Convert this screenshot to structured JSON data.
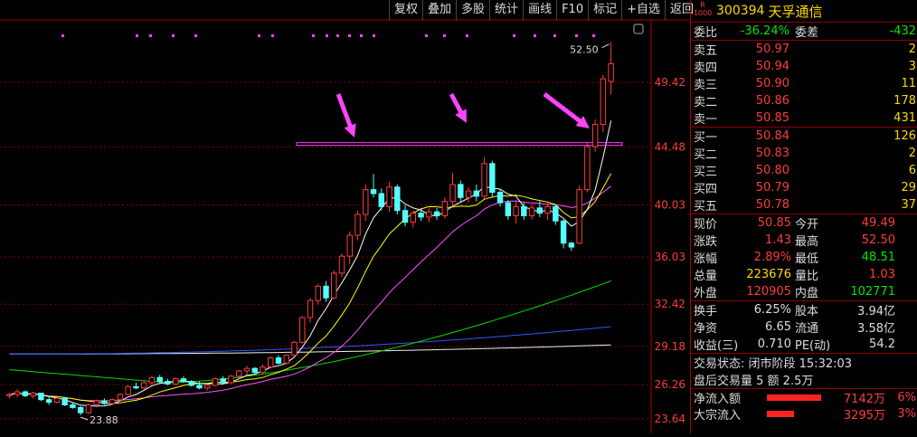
{
  "toolbar": [
    "复权",
    "叠加",
    "多股",
    "统计",
    "画线",
    "F10",
    "标记",
    "+自选",
    "返回"
  ],
  "stock": {
    "badge_top": "R",
    "badge_bottom": "1000",
    "code": "300394",
    "name": "天孚通信"
  },
  "weibi": {
    "label": "委比",
    "value": "-36.24%",
    "label2": "委差",
    "value2": "-432"
  },
  "asks": [
    {
      "label": "卖五",
      "price": "50.97",
      "vol": "2"
    },
    {
      "label": "卖四",
      "price": "50.94",
      "vol": "3"
    },
    {
      "label": "卖三",
      "price": "50.90",
      "vol": "11"
    },
    {
      "label": "卖二",
      "price": "50.86",
      "vol": "178"
    },
    {
      "label": "卖一",
      "price": "50.85",
      "vol": "431"
    }
  ],
  "bids": [
    {
      "label": "买一",
      "price": "50.84",
      "vol": "126"
    },
    {
      "label": "买二",
      "price": "50.83",
      "vol": "2"
    },
    {
      "label": "买三",
      "price": "50.80",
      "vol": "6"
    },
    {
      "label": "买四",
      "price": "50.79",
      "vol": "29"
    },
    {
      "label": "买五",
      "price": "50.78",
      "vol": "37"
    }
  ],
  "quote": [
    {
      "l1": "现价",
      "v1": "50.85",
      "c1": "red",
      "l2": "今开",
      "v2": "49.49",
      "c2": "red"
    },
    {
      "l1": "涨跌",
      "v1": "1.43",
      "c1": "red",
      "l2": "最高",
      "v2": "52.50",
      "c2": "red"
    },
    {
      "l1": "涨幅",
      "v1": "2.89%",
      "c1": "red",
      "l2": "最低",
      "v2": "48.51",
      "c2": "green"
    },
    {
      "l1": "总量",
      "v1": "223676",
      "c1": "yellow",
      "l2": "量比",
      "v2": "1.03",
      "c2": "red"
    },
    {
      "l1": "外盘",
      "v1": "120905",
      "c1": "red",
      "l2": "内盘",
      "v2": "102771",
      "c2": "green"
    }
  ],
  "stats": [
    {
      "l1": "换手",
      "v1": "6.25%",
      "l2": "股本",
      "v2": "3.94亿"
    },
    {
      "l1": "净资",
      "v1": "6.65",
      "l2": "流通",
      "v2": "3.58亿"
    },
    {
      "l1": "收益(三)",
      "v1": "0.710",
      "l2": "PE(动)",
      "v2": "54.2"
    }
  ],
  "status": {
    "line1": "交易状态: 闭市阶段 15:32:03",
    "line2": "盘后交易量 5 额 2.5万"
  },
  "flows": [
    {
      "label": "净流入额",
      "value": "7142万",
      "pct": "6%",
      "ratio": 0.6
    },
    {
      "label": "大宗流入",
      "value": "3295万",
      "pct": "3%",
      "ratio": 0.3
    }
  ],
  "colors": {
    "up": "#ff3c3c",
    "down": "#54ffff",
    "ma5": "#ffffff",
    "ma10": "#ffff00",
    "ma20": "#ff55ff",
    "ma60": "#00dd00",
    "ma120": "#3355ff",
    "ma250": "#eeeeee",
    "annotation": "#ff44ff"
  },
  "chart_data": {
    "type": "candlestick",
    "y_ticks": [
      "49.42",
      "44.48",
      "40.03",
      "36.03",
      "32.42",
      "29.18",
      "26.26",
      "23.64"
    ],
    "ylim": [
      23.0,
      53.8
    ],
    "hline": 44.7,
    "high_label": "52.50",
    "low_label": "23.88",
    "candles": [
      [
        25.4,
        25.6,
        25.2,
        25.5
      ],
      [
        25.5,
        25.9,
        25.3,
        25.7
      ],
      [
        25.7,
        25.8,
        25.3,
        25.4
      ],
      [
        25.4,
        25.7,
        25.2,
        25.6
      ],
      [
        25.6,
        25.6,
        25.0,
        25.1
      ],
      [
        25.1,
        25.3,
        24.7,
        24.9
      ],
      [
        24.9,
        25.3,
        24.8,
        25.2
      ],
      [
        25.2,
        25.3,
        24.6,
        24.7
      ],
      [
        24.7,
        24.9,
        24.4,
        24.5
      ],
      [
        24.5,
        24.6,
        23.9,
        24.1
      ],
      [
        24.1,
        24.8,
        24.0,
        24.7
      ],
      [
        24.7,
        25.1,
        24.5,
        25.0
      ],
      [
        25.0,
        25.2,
        24.7,
        24.8
      ],
      [
        24.8,
        25.2,
        24.7,
        25.1
      ],
      [
        25.1,
        25.6,
        25.0,
        25.5
      ],
      [
        25.5,
        26.2,
        25.4,
        26.1
      ],
      [
        26.1,
        26.4,
        25.9,
        26.0
      ],
      [
        26.0,
        26.5,
        25.9,
        26.4
      ],
      [
        26.4,
        26.9,
        26.2,
        26.8
      ],
      [
        26.8,
        27.0,
        26.4,
        26.5
      ],
      [
        26.5,
        26.7,
        26.2,
        26.3
      ],
      [
        26.3,
        26.8,
        26.2,
        26.7
      ],
      [
        26.7,
        26.9,
        26.4,
        26.5
      ],
      [
        26.5,
        26.6,
        26.1,
        26.2
      ],
      [
        26.2,
        26.5,
        25.9,
        26.0
      ],
      [
        26.0,
        26.3,
        25.8,
        26.2
      ],
      [
        26.2,
        26.8,
        26.1,
        26.7
      ],
      [
        26.7,
        26.9,
        26.3,
        26.4
      ],
      [
        26.4,
        27.0,
        26.3,
        26.9
      ],
      [
        26.9,
        27.4,
        26.7,
        27.3
      ],
      [
        27.3,
        27.7,
        27.0,
        27.5
      ],
      [
        27.5,
        27.6,
        27.1,
        27.2
      ],
      [
        27.2,
        27.8,
        27.1,
        27.6
      ],
      [
        27.6,
        28.4,
        27.5,
        28.3
      ],
      [
        28.3,
        28.5,
        27.8,
        27.9
      ],
      [
        27.9,
        28.6,
        27.8,
        28.5
      ],
      [
        28.5,
        29.6,
        28.4,
        29.5
      ],
      [
        29.5,
        31.5,
        29.4,
        31.4
      ],
      [
        31.4,
        32.9,
        31.0,
        32.7
      ],
      [
        32.7,
        34.0,
        32.4,
        33.8
      ],
      [
        33.8,
        34.2,
        32.6,
        32.9
      ],
      [
        32.9,
        35.0,
        32.8,
        34.8
      ],
      [
        34.8,
        36.3,
        34.5,
        36.1
      ],
      [
        36.1,
        38.0,
        35.5,
        37.7
      ],
      [
        37.7,
        39.6,
        37.3,
        39.3
      ],
      [
        39.3,
        41.6,
        38.8,
        41.2
      ],
      [
        41.2,
        42.4,
        40.6,
        40.9
      ],
      [
        40.9,
        41.3,
        39.6,
        39.9
      ],
      [
        39.9,
        41.8,
        39.5,
        41.4
      ],
      [
        41.4,
        41.6,
        39.3,
        39.6
      ],
      [
        39.6,
        40.0,
        38.4,
        38.7
      ],
      [
        38.7,
        39.6,
        38.3,
        39.4
      ],
      [
        39.4,
        39.8,
        38.8,
        39.1
      ],
      [
        39.1,
        39.8,
        38.7,
        39.5
      ],
      [
        39.5,
        39.8,
        38.9,
        39.2
      ],
      [
        39.2,
        40.6,
        39.0,
        40.3
      ],
      [
        40.3,
        42.5,
        39.9,
        41.6
      ],
      [
        41.6,
        41.9,
        40.3,
        40.6
      ],
      [
        40.6,
        41.4,
        40.2,
        41.1
      ],
      [
        41.1,
        41.6,
        40.3,
        40.7
      ],
      [
        40.7,
        43.7,
        40.5,
        43.2
      ],
      [
        43.2,
        43.4,
        40.6,
        41.0
      ],
      [
        41.0,
        41.2,
        39.9,
        40.2
      ],
      [
        40.2,
        40.4,
        38.9,
        39.2
      ],
      [
        39.2,
        40.3,
        38.6,
        39.9
      ],
      [
        39.9,
        40.2,
        38.9,
        39.2
      ],
      [
        39.2,
        40.1,
        38.9,
        39.8
      ],
      [
        39.8,
        40.3,
        39.1,
        39.4
      ],
      [
        39.4,
        40.2,
        38.9,
        39.9
      ],
      [
        39.9,
        40.1,
        38.5,
        38.8
      ],
      [
        38.8,
        38.9,
        36.7,
        37.1
      ],
      [
        37.1,
        37.2,
        36.5,
        36.8
      ],
      [
        37.1,
        41.5,
        37.0,
        41.2
      ],
      [
        41.2,
        44.8,
        41.0,
        44.5
      ],
      [
        44.5,
        46.6,
        44.1,
        46.2
      ],
      [
        46.2,
        50.0,
        45.6,
        49.7
      ],
      [
        49.5,
        52.5,
        48.5,
        50.85
      ]
    ]
  }
}
